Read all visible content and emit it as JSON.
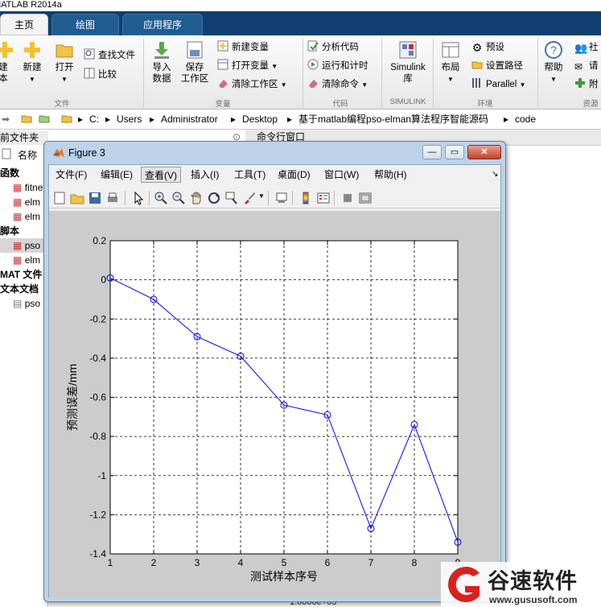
{
  "app": {
    "window_title": "MATLAB R2014a",
    "tabs": [
      {
        "label": "主页",
        "active": true
      },
      {
        "label": "绘图",
        "active": false
      },
      {
        "label": "应用程序",
        "active": false
      }
    ]
  },
  "toolstrip": {
    "file_group": "文件",
    "variable_group": "变量",
    "code_group": "代码",
    "simulink_group": "SIMULINK",
    "env_group": "环境",
    "resource_group": "资源",
    "new_script_partial": "建\n本",
    "new_label": "新建",
    "open_label": "打开",
    "find_files": "查找文件",
    "compare": "比较",
    "import_data": "导入\n数据",
    "save_workspace": "保存\n工作区",
    "new_variable": "新建变量",
    "open_variable": "打开变量",
    "clear_workspace": "清除工作区",
    "analyze_code": "分析代码",
    "run_and_time": "运行和计时",
    "clear_commands": "清除命令",
    "simulink": "Simulink\n库",
    "layout": "布局",
    "preferences": "预设",
    "set_path": "设置路径",
    "parallel": "Parallel",
    "help": "帮助",
    "community_partial": "社",
    "request_partial": "请",
    "addons_partial": "附"
  },
  "address": {
    "segments": [
      "C:",
      "Users",
      "Administrator",
      "Desktop",
      "基于matlab编程pso-elman算法程序智能源码",
      "code"
    ]
  },
  "current_folder": {
    "title": "前文件夹",
    "name_header": "名称",
    "rows": [
      {
        "text": "函数",
        "bold": true
      },
      {
        "text": "fitne",
        "bold": false
      },
      {
        "text": "elm",
        "bold": false
      },
      {
        "text": "elm",
        "bold": false
      },
      {
        "text": "脚本",
        "bold": true
      },
      {
        "text": "pso",
        "bold": false
      },
      {
        "text": "elm",
        "bold": false
      },
      {
        "text": "MAT 文件",
        "bold": true
      },
      {
        "text": "文本文档",
        "bold": true
      },
      {
        "text": "pso",
        "bold": false
      }
    ]
  },
  "command_window": {
    "title": "命令行窗口",
    "output_partial": "1.0000e+03"
  },
  "figure": {
    "title": "Figure 3",
    "menus": [
      "文件(F)",
      "编辑(E)",
      "查看(V)",
      "插入(I)",
      "工具(T)",
      "桌面(D)",
      "窗口(W)",
      "帮助(H)"
    ],
    "selected_menu": "查看(V)"
  },
  "chart_data": {
    "type": "line",
    "title": "",
    "xlabel": "测试样本序号",
    "ylabel": "预测误差/mm",
    "x": [
      1,
      2,
      3,
      4,
      5,
      6,
      7,
      8,
      9
    ],
    "series": [
      {
        "values": [
          0.01,
          -0.1,
          -0.29,
          -0.39,
          -0.64,
          -0.69,
          -1.27,
          -0.74,
          -1.34
        ],
        "color": "#0000ff",
        "marker": "circle"
      }
    ],
    "xlim": [
      1,
      9
    ],
    "ylim": [
      -1.4,
      0.2
    ],
    "xticks": [
      "1",
      "2",
      "3",
      "4",
      "5",
      "6",
      "7",
      "8",
      "9"
    ],
    "yticks": [
      "0.2",
      "0",
      "-0.2",
      "-0.4",
      "-0.6",
      "-0.8",
      "-1",
      "-1.2",
      "-1.4"
    ],
    "grid": true
  },
  "watermark": {
    "brand": "谷速软件",
    "url": "www.gususoft.com",
    "color": "#d8231f"
  }
}
